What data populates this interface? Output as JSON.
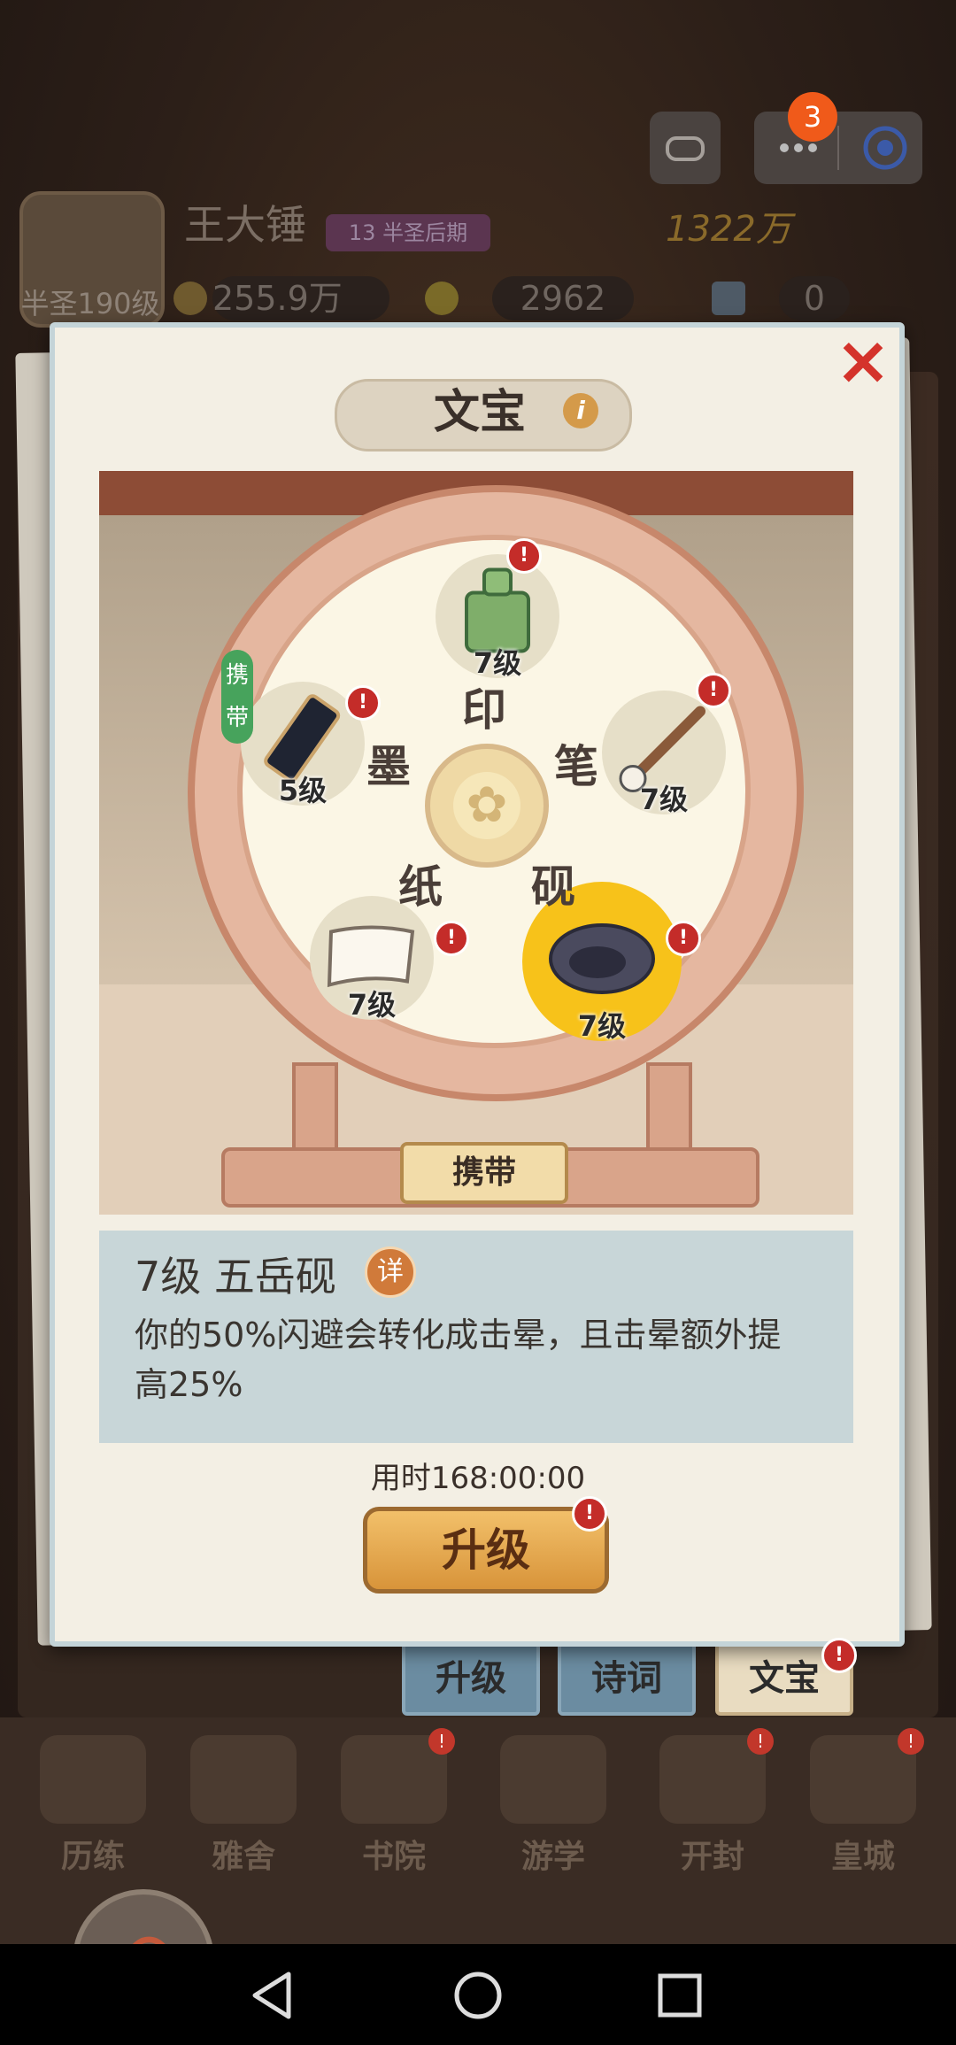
{
  "top_bar": {
    "notification_count": "3",
    "player_name": "王大锤",
    "rank": "13 半圣后期",
    "avatar_label": "半圣190级",
    "power": "1322万",
    "resources": [
      "255.9万",
      "2962",
      "0"
    ]
  },
  "modal": {
    "title": "文宝",
    "close": "×",
    "info": "i",
    "carry_tag": "携带",
    "carry_button": "携带",
    "slots": [
      {
        "name": "印",
        "level": "7级"
      },
      {
        "name": "笔",
        "level": "7级"
      },
      {
        "name": "砚",
        "level": "7级"
      },
      {
        "name": "纸",
        "level": "7级"
      },
      {
        "name": "墨",
        "level": "5级"
      }
    ],
    "alert_mark": "!",
    "selected": {
      "title": "7级 五岳砚",
      "detail": "详",
      "description": "你的50%闪避会转化成击晕，且击晕额外提高25%"
    },
    "time": "用时168:00:00",
    "upgrade_button": "升级"
  },
  "tabs": [
    "升级",
    "诗词",
    "文宝"
  ],
  "bottom_nav": [
    "历练",
    "雅舍",
    "书院",
    "游学",
    "开封",
    "皇城"
  ],
  "colors": {
    "accent_red": "#c42c29",
    "selected_gold": "#f7c21a",
    "upgrade_orange": "#d8943a"
  }
}
